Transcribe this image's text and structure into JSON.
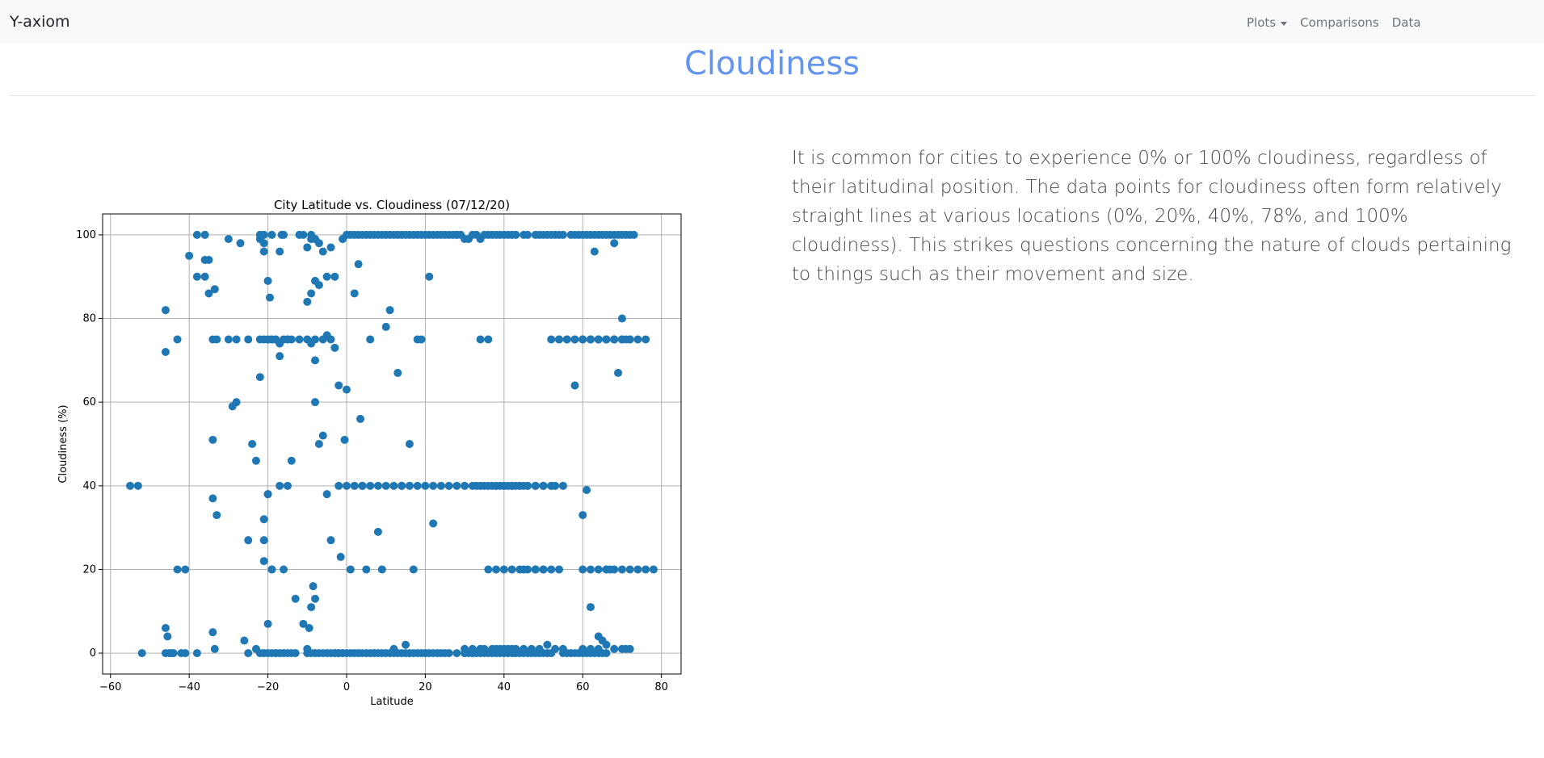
{
  "navbar": {
    "brand": "Y-axiom",
    "items": [
      {
        "label": "Plots",
        "dropdown": true
      },
      {
        "label": "Comparisons",
        "dropdown": false
      },
      {
        "label": "Data",
        "dropdown": false
      }
    ]
  },
  "page_title": "Cloudiness",
  "description": "It is common for cities to experience 0% or 100% cloudiness, regardless of their latitudinal position. The data points for cloudiness often form relatively straight lines at various locations (0%, 20%, 40%, 78%, and 100% cloudiness). This strikes questions concerning the nature of clouds pertaining to things such as their movement and size.",
  "colors": {
    "accent": "#6495ed",
    "points": "#1f77b4",
    "navbar_bg": "#f8f9fa"
  },
  "chart_data": {
    "type": "scatter",
    "title": "City Latitude vs. Cloudiness (07/12/20)",
    "xlabel": "Latitude",
    "ylabel": "Cloudiness (%)",
    "xlim": [
      -62,
      85
    ],
    "ylim": [
      -5,
      105
    ],
    "x_ticks": [
      -60,
      -40,
      -20,
      0,
      20,
      40,
      60,
      80
    ],
    "y_ticks": [
      0,
      20,
      40,
      60,
      80,
      100
    ],
    "grid": true,
    "point_color": "#1f77b4",
    "x": [
      -55,
      -53,
      -52,
      -46,
      -46,
      -45.5,
      -45,
      -44.5,
      -43,
      -42,
      -41,
      -46,
      -46,
      -44,
      -43,
      -41,
      -40,
      -38,
      -38,
      -38,
      -36,
      -36,
      -36,
      -35,
      -35,
      -34,
      -34,
      -34,
      -33.5,
      -34,
      -33.5,
      -33,
      -30,
      -29,
      -28,
      -27,
      -26,
      -25,
      -24,
      -23,
      -22,
      -22,
      -21,
      -21,
      -21,
      -20,
      -20,
      -19.5,
      -19,
      -19,
      -18,
      -18,
      -17,
      -16.5,
      -16,
      -15,
      -14,
      -13,
      -12,
      -11,
      -10,
      -9.5,
      -9,
      -8.5,
      -8,
      -7,
      -6,
      -5,
      -4,
      -3,
      -2,
      -1.5,
      -1,
      -0.5,
      0,
      1,
      2,
      3,
      3.5,
      4,
      5,
      6,
      7,
      8,
      9,
      10,
      11,
      12,
      13,
      14,
      15,
      16,
      17,
      18,
      19,
      20,
      21,
      22,
      -21,
      -20,
      -19,
      -21,
      -20,
      -19,
      -22,
      -21,
      -20,
      -19,
      -17,
      -16,
      -15,
      -17,
      -16,
      -15,
      -11,
      -10,
      -9,
      -8,
      -7,
      -6,
      -5,
      -4,
      -3,
      -9,
      -8,
      -9,
      -8,
      -7,
      -5,
      -10,
      -9,
      -8,
      -22,
      -21,
      -17,
      -23,
      -25,
      -21,
      -20,
      -19,
      -18,
      -17,
      -16,
      -15,
      -14,
      -13,
      -10,
      -9,
      -8,
      -7,
      -6,
      -5,
      -4,
      -3,
      -2,
      -1,
      0,
      1,
      2,
      3,
      4,
      5,
      6,
      7,
      8,
      9,
      10,
      11,
      12,
      13,
      14,
      15,
      16,
      17,
      18,
      19,
      20,
      21,
      22,
      23,
      24,
      25,
      26,
      -3,
      -2,
      -1,
      0,
      1,
      2,
      3,
      4,
      5,
      6,
      7,
      8,
      9,
      10,
      11,
      12,
      13,
      14,
      15,
      16,
      17,
      18,
      19,
      20,
      21,
      22,
      23,
      24,
      25,
      26,
      27,
      28,
      30,
      31,
      32,
      33,
      34,
      35,
      36,
      37,
      38,
      39,
      40,
      41,
      42,
      43,
      45,
      46,
      48,
      49,
      50,
      51,
      52,
      53,
      54,
      55,
      57,
      58,
      59,
      60,
      61,
      62,
      63,
      64,
      65,
      66,
      67,
      68,
      69,
      70,
      71,
      72,
      73,
      28,
      29,
      30,
      31,
      32,
      33,
      34,
      35,
      36,
      37,
      38,
      39,
      40,
      41,
      42,
      43,
      44,
      45,
      46,
      47,
      48,
      49,
      50,
      51,
      52,
      55,
      56,
      57,
      58,
      59,
      60,
      61,
      62,
      63,
      64,
      65,
      66,
      28,
      30,
      32,
      34,
      35,
      37,
      38,
      39,
      40,
      41,
      42,
      43,
      45,
      47,
      49,
      51,
      53,
      55,
      60,
      62,
      64,
      66,
      68,
      70,
      71,
      72,
      30,
      32,
      34,
      36,
      38,
      40,
      42,
      44,
      46,
      48,
      50,
      52,
      54,
      60,
      62,
      64,
      66,
      68,
      70,
      72,
      74,
      76,
      78,
      45,
      48,
      50,
      52,
      54,
      56,
      58,
      60,
      62,
      64,
      66,
      68,
      70,
      72,
      74,
      76,
      60,
      62,
      64,
      66,
      68,
      70,
      71,
      72,
      34,
      36,
      38,
      40,
      42,
      44,
      46,
      48,
      50,
      52,
      54,
      56,
      58,
      60,
      62,
      64,
      66,
      68,
      70,
      -33,
      -30,
      -28,
      -25,
      -22,
      -21,
      -20,
      -18,
      -16,
      -14,
      -12,
      -10,
      -8,
      -6,
      -4,
      -2,
      0,
      2,
      4,
      6,
      8,
      10,
      12,
      14,
      16,
      18,
      20,
      22,
      24,
      26,
      28,
      30,
      32,
      33,
      34,
      35,
      36,
      37,
      38,
      39,
      40,
      41,
      42,
      43,
      44,
      45,
      46,
      48,
      50,
      52,
      53,
      55,
      58,
      60,
      61,
      62,
      63,
      64,
      65,
      66,
      67,
      68,
      69,
      70
    ],
    "y": [
      40,
      40,
      0,
      6,
      0,
      4,
      0,
      0,
      20,
      0,
      0,
      82,
      72,
      0,
      75,
      20,
      95,
      0,
      100,
      90,
      94,
      90,
      100,
      86,
      94,
      75,
      51,
      37,
      87,
      5,
      1,
      33,
      99,
      59,
      60,
      98,
      3,
      27,
      50,
      46,
      0,
      66,
      22,
      27,
      32,
      7,
      38,
      85,
      75,
      20,
      0,
      75,
      74,
      100,
      0,
      40,
      46,
      13,
      100,
      7,
      1,
      6,
      11,
      16,
      13,
      50,
      52,
      38,
      27,
      73,
      64,
      23,
      0,
      51,
      63,
      20,
      86,
      93,
      56,
      40,
      20,
      75,
      0,
      29,
      20,
      78,
      82,
      1,
      67,
      40,
      2,
      50,
      20,
      75,
      75,
      0,
      90,
      31,
      0,
      38,
      20,
      100,
      75,
      100,
      100,
      96,
      89,
      75,
      96,
      20,
      75,
      40,
      100,
      75,
      100,
      97,
      99,
      99,
      88,
      96,
      90,
      97,
      90,
      100,
      89,
      86,
      70,
      98,
      76,
      84,
      74,
      60,
      99,
      98,
      71,
      1,
      0,
      0,
      0,
      0,
      0,
      0,
      0,
      0,
      0,
      0,
      0,
      0,
      0,
      0,
      0,
      0,
      0,
      0,
      0,
      0,
      0,
      0,
      0,
      0,
      0,
      0,
      0,
      0,
      0,
      0,
      0,
      0,
      0,
      0,
      0,
      0,
      0,
      0,
      0,
      0,
      0,
      0,
      0,
      0,
      0,
      0,
      0,
      0,
      0,
      99,
      100,
      100,
      100,
      100,
      100,
      100,
      100,
      100,
      100,
      100,
      100,
      100,
      100,
      100,
      100,
      100,
      100,
      100,
      100,
      100,
      100,
      100,
      100,
      100,
      100,
      100,
      100,
      100,
      100,
      99,
      99,
      100,
      100,
      99,
      100,
      100,
      100,
      100,
      100,
      100,
      100,
      100,
      100,
      100,
      100,
      100,
      100,
      100,
      100,
      100,
      100,
      100,
      100,
      100,
      100,
      100,
      100,
      100,
      100,
      100,
      100,
      100,
      100,
      100,
      100,
      100,
      100,
      100,
      100,
      100,
      100,
      100,
      0,
      0,
      0,
      0,
      0,
      0,
      0,
      0,
      0,
      0,
      0,
      0,
      0,
      0,
      0,
      0,
      0,
      0,
      0,
      0,
      0,
      0,
      0,
      0,
      0,
      0,
      0,
      0,
      0,
      0,
      0,
      0,
      0,
      0,
      0,
      0,
      0,
      0,
      1,
      1,
      1,
      1,
      1,
      1,
      1,
      1,
      1,
      1,
      1,
      1,
      2,
      1,
      1,
      1,
      1,
      1,
      2,
      1,
      1,
      1,
      1,
      1,
      1,
      1,
      20,
      20,
      20,
      20,
      20,
      20,
      20,
      20,
      20,
      20,
      20,
      20,
      20,
      20,
      20,
      20,
      20,
      20,
      20,
      20,
      20,
      20,
      20,
      75,
      75,
      75,
      75,
      75,
      75,
      75,
      75,
      75,
      75,
      75,
      75,
      75,
      75,
      75,
      75,
      75,
      75,
      75,
      75,
      75,
      75,
      75,
      40,
      40,
      40,
      40,
      40,
      40,
      40,
      40,
      75,
      75,
      75,
      75,
      75,
      75,
      75,
      75,
      75,
      75,
      75,
      75,
      75,
      75,
      75,
      75,
      75,
      75,
      75,
      75,
      75,
      75,
      75,
      75,
      40,
      40,
      40,
      40,
      40,
      40,
      40,
      40,
      40,
      40,
      40,
      40,
      40,
      40,
      40,
      40,
      40,
      40,
      40,
      40,
      40,
      40,
      40,
      40,
      40,
      40,
      40,
      40,
      40,
      40,
      40,
      40,
      40,
      40,
      40,
      40,
      40,
      64,
      33,
      39,
      11,
      96,
      4,
      3,
      20,
      20,
      98,
      67,
      80,
      86,
      70,
      65,
      89,
      90,
      90,
      70,
      68,
      88,
      75,
      96,
      76,
      58,
      98,
      83,
      50,
      91,
      89,
      78,
      63
    ]
  }
}
